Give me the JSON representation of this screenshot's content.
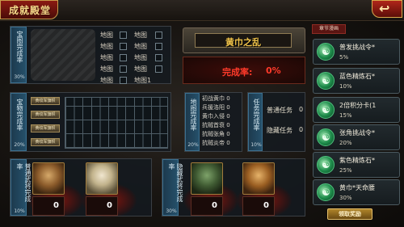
{
  "header": {
    "title": "成就殿堂",
    "back_icon": "back-arrow-icon"
  },
  "treasure_map": {
    "label": "宝图完成率",
    "percent": "30%",
    "slots": [
      "地图",
      "地图",
      "地图",
      "地图",
      "地图",
      "地图",
      "地图",
      "地图",
      "地图",
      "地图1"
    ]
  },
  "chapter": {
    "title": "黄巾之乱",
    "completion_label": "完成率:",
    "completion_value": "0%"
  },
  "treasure_items": {
    "label": "宝物完成率",
    "percent": "20%",
    "flags": [
      "黄纹军旗帜",
      "黄纹军旗帜",
      "黄纹军旗帜",
      "黄纹军旗帜"
    ]
  },
  "map_progress": {
    "label": "地图完成率",
    "percent": "20%",
    "rows": [
      "初战黄巾 0",
      "兵援洛阳 0",
      "黄巾入侵 0",
      "抗贼首衰 0",
      "抗贼张角 0",
      "抗贼炎帝 0"
    ]
  },
  "task_progress": {
    "label": "任务完成率",
    "percent": "10%",
    "rows": [
      {
        "name": "普通任务",
        "count": "0"
      },
      {
        "name": "隐藏任务",
        "count": "0"
      }
    ]
  },
  "normal_generals": {
    "label": "普通武将完成率",
    "percent": "10%",
    "cards": [
      {
        "count": "0"
      },
      {
        "count": "0"
      }
    ]
  },
  "hidden_generals": {
    "label": "隐藏武将完成率",
    "percent": "30%",
    "cards": [
      {
        "count": "0"
      },
      {
        "count": "0"
      }
    ]
  },
  "rewards": {
    "section_title": "章节漫画",
    "items": [
      {
        "name": "普发挑战令*",
        "pct": "5%"
      },
      {
        "name": "蓝色精炼石*",
        "pct": "10%"
      },
      {
        "name": "2倍积分卡(1",
        "pct": "15%"
      },
      {
        "name": "张角挑战令*",
        "pct": "20%"
      },
      {
        "name": "紫色精炼石*",
        "pct": "25%"
      },
      {
        "name": "黄巾*天命腰",
        "pct": "30%"
      }
    ],
    "claim_label": "领取奖励"
  },
  "colors": {
    "accent_gold": "#f0c34a",
    "completion_red": "#ff3a2a",
    "reward_green": "#1c8a49"
  }
}
